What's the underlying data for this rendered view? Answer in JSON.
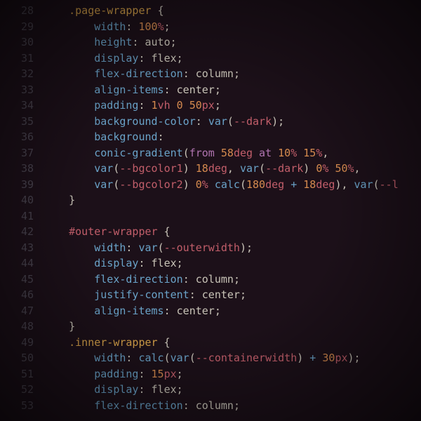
{
  "editor": {
    "first_line_number": 28,
    "indent": "    ",
    "lines": [
      {
        "n": 28,
        "tokens": [
          {
            "t": ".page-wrapper ",
            "c": "tok-selector-class"
          },
          {
            "t": "{",
            "c": "tok-brace"
          }
        ]
      },
      {
        "n": 29,
        "indent": 2,
        "tokens": [
          {
            "t": "width",
            "c": "tok-prop"
          },
          {
            "t": ": ",
            "c": "tok-colon"
          },
          {
            "t": "100",
            "c": "tok-number"
          },
          {
            "t": "%",
            "c": "tok-unit"
          },
          {
            "t": ";",
            "c": "tok-semi"
          }
        ]
      },
      {
        "n": 30,
        "indent": 2,
        "tokens": [
          {
            "t": "height",
            "c": "tok-prop"
          },
          {
            "t": ": ",
            "c": "tok-colon"
          },
          {
            "t": "auto",
            "c": "tok-value"
          },
          {
            "t": ";",
            "c": "tok-semi"
          }
        ]
      },
      {
        "n": 31,
        "indent": 2,
        "tokens": [
          {
            "t": "display",
            "c": "tok-prop"
          },
          {
            "t": ": ",
            "c": "tok-colon"
          },
          {
            "t": "flex",
            "c": "tok-value"
          },
          {
            "t": ";",
            "c": "tok-semi"
          }
        ]
      },
      {
        "n": 32,
        "indent": 2,
        "tokens": [
          {
            "t": "flex-direction",
            "c": "tok-prop"
          },
          {
            "t": ": ",
            "c": "tok-colon"
          },
          {
            "t": "column",
            "c": "tok-value"
          },
          {
            "t": ";",
            "c": "tok-semi"
          }
        ]
      },
      {
        "n": 33,
        "indent": 2,
        "tokens": [
          {
            "t": "align-items",
            "c": "tok-prop"
          },
          {
            "t": ": ",
            "c": "tok-colon"
          },
          {
            "t": "center",
            "c": "tok-value"
          },
          {
            "t": ";",
            "c": "tok-semi"
          }
        ]
      },
      {
        "n": 34,
        "indent": 2,
        "tokens": [
          {
            "t": "padding",
            "c": "tok-prop"
          },
          {
            "t": ": ",
            "c": "tok-colon"
          },
          {
            "t": "1",
            "c": "tok-number"
          },
          {
            "t": "vh",
            "c": "tok-unit"
          },
          {
            "t": " ",
            "c": "tok-value"
          },
          {
            "t": "0",
            "c": "tok-number"
          },
          {
            "t": " ",
            "c": "tok-value"
          },
          {
            "t": "50",
            "c": "tok-number"
          },
          {
            "t": "px",
            "c": "tok-unit"
          },
          {
            "t": ";",
            "c": "tok-semi"
          }
        ]
      },
      {
        "n": 35,
        "indent": 2,
        "tokens": [
          {
            "t": "background-color",
            "c": "tok-prop"
          },
          {
            "t": ": ",
            "c": "tok-colon"
          },
          {
            "t": "var",
            "c": "tok-func"
          },
          {
            "t": "(",
            "c": "tok-paren"
          },
          {
            "t": "--dark",
            "c": "tok-varname"
          },
          {
            "t": ")",
            "c": "tok-paren"
          },
          {
            "t": ";",
            "c": "tok-semi"
          }
        ]
      },
      {
        "n": 36,
        "indent": 2,
        "tokens": [
          {
            "t": "background",
            "c": "tok-prop"
          },
          {
            "t": ":",
            "c": "tok-colon"
          }
        ]
      },
      {
        "n": 37,
        "indent": 2,
        "tokens": [
          {
            "t": "conic-gradient",
            "c": "tok-func"
          },
          {
            "t": "(",
            "c": "tok-paren"
          },
          {
            "t": "from ",
            "c": "tok-kw"
          },
          {
            "t": "58",
            "c": "tok-number"
          },
          {
            "t": "deg",
            "c": "tok-unit"
          },
          {
            "t": " at ",
            "c": "tok-kw"
          },
          {
            "t": "10",
            "c": "tok-number"
          },
          {
            "t": "%",
            "c": "tok-unit"
          },
          {
            "t": " ",
            "c": "tok-value"
          },
          {
            "t": "15",
            "c": "tok-number"
          },
          {
            "t": "%",
            "c": "tok-unit"
          },
          {
            "t": ",",
            "c": "tok-value"
          }
        ]
      },
      {
        "n": 38,
        "indent": 2,
        "tokens": [
          {
            "t": "var",
            "c": "tok-func"
          },
          {
            "t": "(",
            "c": "tok-paren"
          },
          {
            "t": "--bgcolor1",
            "c": "tok-varname"
          },
          {
            "t": ")",
            "c": "tok-paren"
          },
          {
            "t": " ",
            "c": "tok-value"
          },
          {
            "t": "18",
            "c": "tok-number"
          },
          {
            "t": "deg",
            "c": "tok-unit"
          },
          {
            "t": ", ",
            "c": "tok-value"
          },
          {
            "t": "var",
            "c": "tok-func"
          },
          {
            "t": "(",
            "c": "tok-paren"
          },
          {
            "t": "--dark",
            "c": "tok-varname"
          },
          {
            "t": ")",
            "c": "tok-paren"
          },
          {
            "t": " ",
            "c": "tok-value"
          },
          {
            "t": "0",
            "c": "tok-number"
          },
          {
            "t": "%",
            "c": "tok-unit"
          },
          {
            "t": " ",
            "c": "tok-value"
          },
          {
            "t": "50",
            "c": "tok-number"
          },
          {
            "t": "%",
            "c": "tok-unit"
          },
          {
            "t": ",",
            "c": "tok-value"
          }
        ]
      },
      {
        "n": 39,
        "indent": 2,
        "tokens": [
          {
            "t": "var",
            "c": "tok-func"
          },
          {
            "t": "(",
            "c": "tok-paren"
          },
          {
            "t": "--bgcolor2",
            "c": "tok-varname"
          },
          {
            "t": ")",
            "c": "tok-paren"
          },
          {
            "t": " ",
            "c": "tok-value"
          },
          {
            "t": "0",
            "c": "tok-number"
          },
          {
            "t": "%",
            "c": "tok-unit"
          },
          {
            "t": " ",
            "c": "tok-value"
          },
          {
            "t": "calc",
            "c": "tok-func"
          },
          {
            "t": "(",
            "c": "tok-paren"
          },
          {
            "t": "180",
            "c": "tok-number"
          },
          {
            "t": "deg",
            "c": "tok-unit"
          },
          {
            "t": " + ",
            "c": "tok-op"
          },
          {
            "t": "18",
            "c": "tok-number"
          },
          {
            "t": "deg",
            "c": "tok-unit"
          },
          {
            "t": ")",
            "c": "tok-paren"
          },
          {
            "t": ", ",
            "c": "tok-value"
          },
          {
            "t": "var",
            "c": "tok-func"
          },
          {
            "t": "(",
            "c": "tok-paren"
          },
          {
            "t": "--l",
            "c": "tok-varname"
          }
        ]
      },
      {
        "n": 40,
        "indent": 1,
        "tokens": [
          {
            "t": "}",
            "c": "tok-brace"
          }
        ]
      },
      {
        "n": 41,
        "tokens": []
      },
      {
        "n": 42,
        "indent": 1,
        "tokens": [
          {
            "t": "#outer-wrapper ",
            "c": "tok-selector-id"
          },
          {
            "t": "{",
            "c": "tok-brace"
          }
        ]
      },
      {
        "n": 43,
        "indent": 2,
        "tokens": [
          {
            "t": "width",
            "c": "tok-prop"
          },
          {
            "t": ": ",
            "c": "tok-colon"
          },
          {
            "t": "var",
            "c": "tok-func"
          },
          {
            "t": "(",
            "c": "tok-paren"
          },
          {
            "t": "--outerwidth",
            "c": "tok-varname"
          },
          {
            "t": ")",
            "c": "tok-paren"
          },
          {
            "t": ";",
            "c": "tok-semi"
          }
        ]
      },
      {
        "n": 44,
        "indent": 2,
        "tokens": [
          {
            "t": "display",
            "c": "tok-prop"
          },
          {
            "t": ": ",
            "c": "tok-colon"
          },
          {
            "t": "flex",
            "c": "tok-value"
          },
          {
            "t": ";",
            "c": "tok-semi"
          }
        ]
      },
      {
        "n": 45,
        "indent": 2,
        "tokens": [
          {
            "t": "flex-direction",
            "c": "tok-prop"
          },
          {
            "t": ": ",
            "c": "tok-colon"
          },
          {
            "t": "column",
            "c": "tok-value"
          },
          {
            "t": ";",
            "c": "tok-semi"
          }
        ]
      },
      {
        "n": 46,
        "indent": 2,
        "tokens": [
          {
            "t": "justify-content",
            "c": "tok-prop"
          },
          {
            "t": ": ",
            "c": "tok-colon"
          },
          {
            "t": "center",
            "c": "tok-value"
          },
          {
            "t": ";",
            "c": "tok-semi"
          }
        ]
      },
      {
        "n": 47,
        "indent": 2,
        "tokens": [
          {
            "t": "align-items",
            "c": "tok-prop"
          },
          {
            "t": ": ",
            "c": "tok-colon"
          },
          {
            "t": "center",
            "c": "tok-value"
          },
          {
            "t": ";",
            "c": "tok-semi"
          }
        ]
      },
      {
        "n": 48,
        "indent": 1,
        "tokens": [
          {
            "t": "}",
            "c": "tok-brace"
          }
        ]
      },
      {
        "n": 49,
        "indent": 1,
        "tokens": [
          {
            "t": ".inner-wrapper ",
            "c": "tok-selector-class"
          },
          {
            "t": "{",
            "c": "tok-brace"
          }
        ]
      },
      {
        "n": 50,
        "indent": 2,
        "tokens": [
          {
            "t": "width",
            "c": "tok-prop"
          },
          {
            "t": ": ",
            "c": "tok-colon"
          },
          {
            "t": "calc",
            "c": "tok-func"
          },
          {
            "t": "(",
            "c": "tok-paren"
          },
          {
            "t": "var",
            "c": "tok-func"
          },
          {
            "t": "(",
            "c": "tok-paren"
          },
          {
            "t": "--containerwidth",
            "c": "tok-varname"
          },
          {
            "t": ")",
            "c": "tok-paren"
          },
          {
            "t": " + ",
            "c": "tok-op"
          },
          {
            "t": "30",
            "c": "tok-number"
          },
          {
            "t": "px",
            "c": "tok-unit"
          },
          {
            "t": ")",
            "c": "tok-paren"
          },
          {
            "t": ";",
            "c": "tok-semi"
          }
        ]
      },
      {
        "n": 51,
        "indent": 2,
        "tokens": [
          {
            "t": "padding",
            "c": "tok-prop"
          },
          {
            "t": ": ",
            "c": "tok-colon"
          },
          {
            "t": "15",
            "c": "tok-number"
          },
          {
            "t": "px",
            "c": "tok-unit"
          },
          {
            "t": ";",
            "c": "tok-semi"
          }
        ]
      },
      {
        "n": 52,
        "indent": 2,
        "tokens": [
          {
            "t": "display",
            "c": "tok-prop"
          },
          {
            "t": ": ",
            "c": "tok-colon"
          },
          {
            "t": "flex",
            "c": "tok-value"
          },
          {
            "t": ";",
            "c": "tok-semi"
          }
        ]
      },
      {
        "n": 53,
        "indent": 2,
        "tokens": [
          {
            "t": "flex-direction",
            "c": "tok-prop"
          },
          {
            "t": ": ",
            "c": "tok-colon"
          },
          {
            "t": "column",
            "c": "tok-value"
          },
          {
            "t": ";",
            "c": "tok-semi"
          }
        ]
      }
    ]
  },
  "colors": {
    "background": "#1c1019",
    "gutter": "#4a4450",
    "default": "#c9c4b8",
    "selector_class": "#d7a24a",
    "selector_id": "#c25e6a",
    "property": "#6aa3c9",
    "number": "#d68b4f",
    "unit": "#c25e6a",
    "function": "#6aa3c9",
    "varname": "#c25e6a",
    "keyword": "#b074b0",
    "operator": "#6aa3c9"
  }
}
